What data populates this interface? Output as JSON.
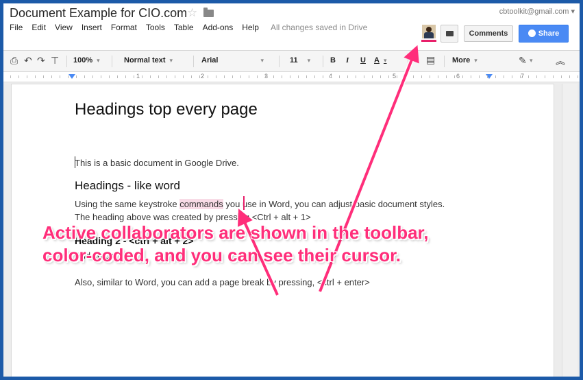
{
  "header": {
    "doc_title": "Document Example for CIO.com",
    "account": "cbtoolkit@gmail.com",
    "star_icon": "star-icon",
    "folder_icon": "folder-icon"
  },
  "menu": {
    "items": [
      "File",
      "Edit",
      "View",
      "Insert",
      "Format",
      "Tools",
      "Table",
      "Add-ons",
      "Help"
    ],
    "save_status": "All changes saved in Drive"
  },
  "collab": {
    "comments_label": "Comments",
    "share_label": "Share",
    "accent_color": "#e81f6a"
  },
  "toolbar": {
    "zoom": "100%",
    "style": "Normal text",
    "font": "Arial",
    "size": "11",
    "bold": "B",
    "italic": "I",
    "underline": "U",
    "textcolor": "A",
    "more": "More"
  },
  "ruler": {
    "numbers": [
      "1",
      "2",
      "3",
      "4",
      "5",
      "6",
      "7"
    ]
  },
  "document": {
    "heading1": "Headings top every page",
    "para1": "This is a basic document in Google Drive.",
    "heading2": "Headings - like word",
    "para2_before": "Using the same keystroke ",
    "para2_highlight": "commands",
    "para2_after": " you use in Word, you can adjust basic document styles.",
    "para3": "The heading above was created by pressing <Ctrl + alt + 1>",
    "heading3": "Heading 2 - <ctrl + alt + 2>",
    "para4": "And so on.",
    "para5": "Also, similar to Word, you can add a page break by pressing, <ctrl + enter>"
  },
  "annotation": {
    "line1": "Active collaborators are shown in the toolbar,",
    "line2": "color-coded, and you can see their cursor.",
    "color": "#ff2e7a"
  }
}
